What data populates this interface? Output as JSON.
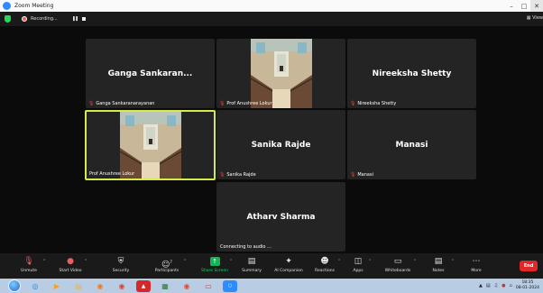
{
  "window": {
    "title": "Zoom Meeting"
  },
  "recording": {
    "label": "Recording...",
    "pause_icon": "pause-icon",
    "stop_icon": "stop-icon"
  },
  "header": {
    "view_label": "View"
  },
  "participants": [
    {
      "display_name": "Ganga Sankaran...",
      "tag": "Ganga Sankaranarayanan",
      "muted": true,
      "video": false
    },
    {
      "display_name": "",
      "tag": "Prof Anushree Lokur",
      "muted": true,
      "video": true
    },
    {
      "display_name": "Nireeksha Shetty",
      "tag": "Nireeksha Shetty",
      "muted": true,
      "video": false
    },
    {
      "display_name": "",
      "tag": "Prof Anushree Lokur",
      "muted": false,
      "video": true,
      "active_speaker": true
    },
    {
      "display_name": "Sanika Rajde",
      "tag": "Sanika Rajde",
      "muted": true,
      "video": false
    },
    {
      "display_name": "Manasi",
      "tag": "Manasi",
      "muted": true,
      "video": false
    },
    {
      "display_name": "Atharv Sharma",
      "tag": "Connecting to audio ...",
      "muted": false,
      "video": false
    }
  ],
  "toolbar": {
    "unmute": "Unmute",
    "start_video": "Start Video",
    "security": "Security",
    "participants": "Participants",
    "participant_count": "7",
    "share_screen": "Share Screen",
    "summary": "Summary",
    "ai_companion": "AI Companion",
    "reactions": "Reactions",
    "apps": "Apps",
    "whiteboards": "Whiteboards",
    "notes": "Notes",
    "more": "More",
    "end": "End"
  },
  "taskbar": {
    "time": "18:35",
    "date": "08-01-2024"
  },
  "colors": {
    "active_speaker_border": "#d8e94c",
    "share_green": "#13b556",
    "end_red": "#e02828",
    "muted_red": "#f04848"
  }
}
